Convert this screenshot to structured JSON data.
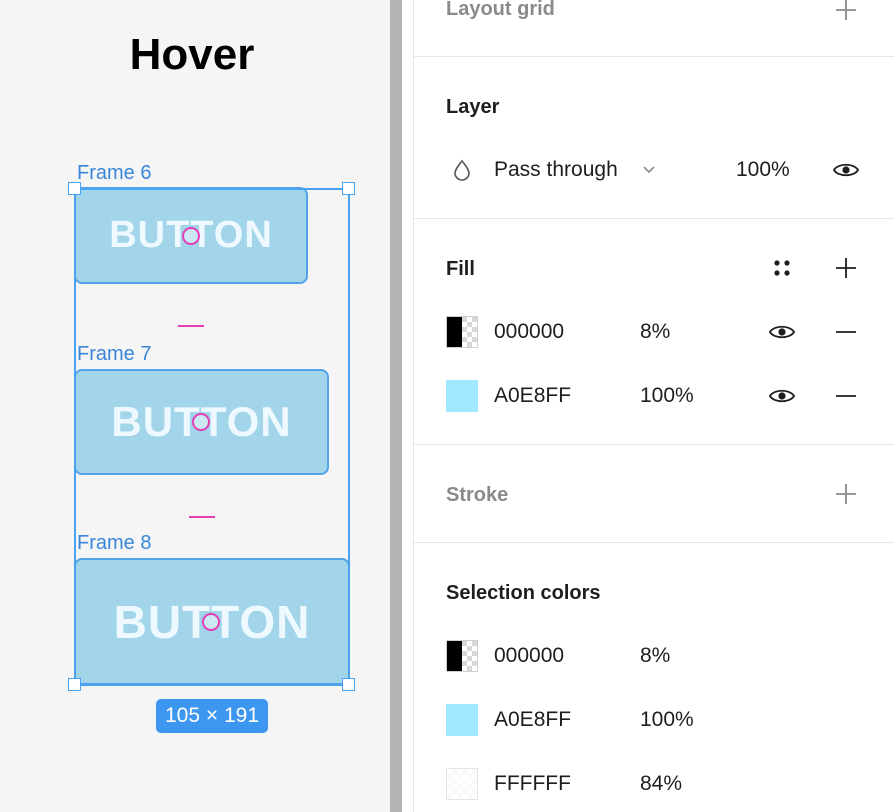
{
  "canvas": {
    "title": "Hover",
    "frames": [
      {
        "label": "Frame 6",
        "button_text": "BUTTON"
      },
      {
        "label": "Frame 7",
        "button_text": "BUTTON"
      },
      {
        "label": "Frame 8",
        "button_text": "BUTTON"
      }
    ],
    "selection_size": "105 × 191",
    "selection_color": "#4aa3f0",
    "button_fill": "#a2d5ea"
  },
  "panel": {
    "layout_grid": {
      "title": "Layout grid",
      "add_icon": "plus-icon"
    },
    "layer": {
      "title": "Layer",
      "blend_mode": "Pass through",
      "opacity": "100%",
      "visibility_icon": "eye-icon"
    },
    "fill": {
      "title": "Fill",
      "styles_icon": "four-dots-icon",
      "add_icon": "plus-icon",
      "items": [
        {
          "hex": "000000",
          "opacity": "8%",
          "color": "#000000"
        },
        {
          "hex": "A0E8FF",
          "opacity": "100%",
          "color": "#A0E8FF"
        }
      ]
    },
    "stroke": {
      "title": "Stroke",
      "add_icon": "plus-icon"
    },
    "selection_colors": {
      "title": "Selection colors",
      "items": [
        {
          "hex": "000000",
          "opacity": "8%",
          "color": "#000000"
        },
        {
          "hex": "A0E8FF",
          "opacity": "100%",
          "color": "#A0E8FF"
        },
        {
          "hex": "FFFFFF",
          "opacity": "84%",
          "color": "#FFFFFF"
        }
      ]
    }
  }
}
